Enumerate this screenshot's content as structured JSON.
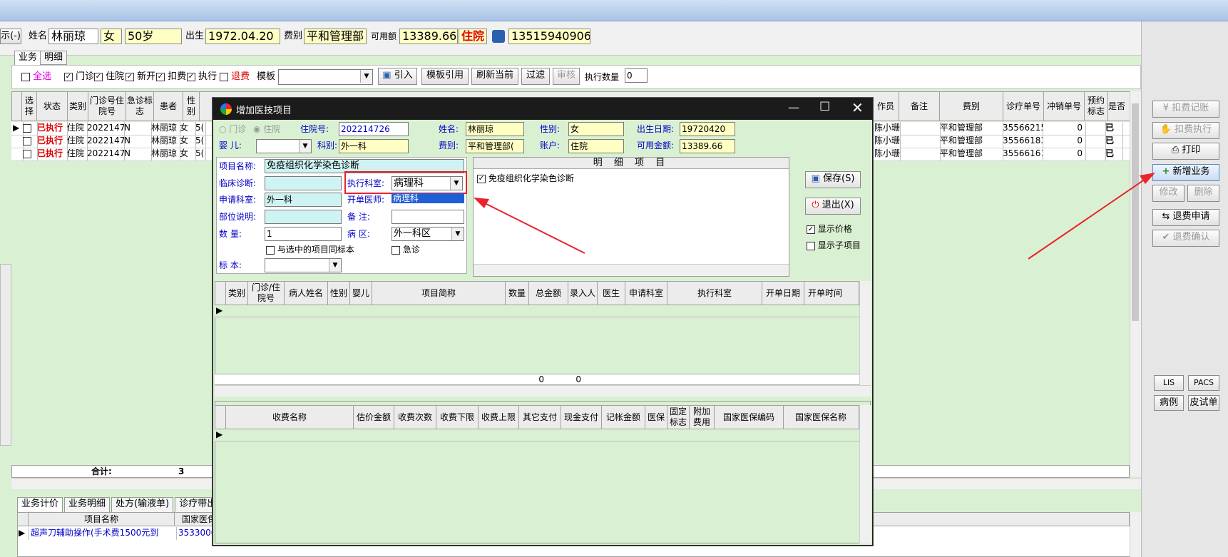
{
  "header": {
    "left_btn": "示(-)",
    "name_label": "姓名",
    "name": "林丽琼",
    "gender": "女",
    "age": "50岁",
    "birth_label": "出生",
    "birth": "1972.04.20",
    "fee_label": "费别",
    "fee": "平和管理部",
    "avail_label": "可用额",
    "avail": "13389.66",
    "status": "住院",
    "phone": "13515940906"
  },
  "tabs": {
    "biz": "业务",
    "detail": "明细"
  },
  "filters": {
    "all": "全选",
    "outpatient": "门诊",
    "inpatient": "住院",
    "new": "新开",
    "charge": "扣费",
    "execute": "执行",
    "refund": "退费",
    "template_label": "模板",
    "import_btn": "引入",
    "tpl_ref": "模板引用",
    "refresh": "刷新当前",
    "filter": "过滤",
    "audit": "审核",
    "exec_qty_label": "执行数量",
    "exec_qty": "0"
  },
  "main_grid": {
    "headers_left": [
      "选择",
      "状态",
      "类别",
      "门诊号住院号",
      "急诊标志",
      "患者",
      "性别"
    ],
    "headers_right": [
      "作员",
      "备注",
      "费别",
      "诊疗单号",
      "冲销单号",
      "预约标志",
      "是否"
    ],
    "rows": [
      {
        "status": "已执行",
        "type": "住院",
        "no": "2022147",
        "urgent": "N",
        "patient": "林丽琼",
        "gender": "女",
        "age": "5(",
        "op": "陈小珊",
        "fee": "平和管理部",
        "order": "35566215",
        "offset": "0",
        "flag": "已"
      },
      {
        "status": "已执行",
        "type": "住院",
        "no": "2022147",
        "urgent": "N",
        "patient": "林丽琼",
        "gender": "女",
        "age": "5(",
        "op": "陈小珊",
        "fee": "平和管理部",
        "order": "35566183",
        "offset": "0",
        "flag": "已"
      },
      {
        "status": "已执行",
        "type": "住院",
        "no": "2022147",
        "urgent": "N",
        "patient": "林丽琼",
        "gender": "女",
        "age": "5(",
        "op": "陈小珊",
        "fee": "平和管理部",
        "order": "35566161",
        "offset": "0",
        "flag": "已"
      }
    ],
    "total_label": "合计:",
    "total": "3"
  },
  "bottom_tabs": [
    "业务计价",
    "业务明细",
    "处方(输液单)",
    "诊疗带出"
  ],
  "bottom_grid": {
    "headers": [
      "项目名称",
      "国家医保编"
    ],
    "row": {
      "name": "超声刀辅助操作(手术费1500元到",
      "code": "35330000"
    }
  },
  "right_buttons": {
    "charge_record": "扣费记账",
    "charge_exec": "扣费执行",
    "print": "打印",
    "new_biz": "新增业务",
    "modify": "修改",
    "delete": "删除",
    "refund_apply": "退费申请",
    "refund_confirm": "退费确认",
    "lis": "LIS",
    "pacs": "PACS",
    "case": "病例",
    "skin": "皮试单"
  },
  "dialog": {
    "title": "增加医技项目",
    "outpatient": "门诊",
    "inpatient": "住院",
    "admit_no_label": "住院号:",
    "admit_no": "202214726",
    "name_label": "姓名:",
    "name": "林丽琼",
    "gender_label": "性别:",
    "gender": "女",
    "birth_label": "出生日期:",
    "birth": "19720420",
    "baby_label": "婴 儿:",
    "dept_label": "科别:",
    "dept": "外一科",
    "fee_label": "费别:",
    "fee": "平和管理部(",
    "account_label": "账户:",
    "account": "住院",
    "avail_label": "可用金额:",
    "avail": "13389.66",
    "item_label": "项目名称:",
    "item": "免疫组织化学染色诊断",
    "diag_label": "临床诊断:",
    "exec_dept_label": "执行科室:",
    "exec_dept": "病理科",
    "apply_dept_label": "申请科室:",
    "apply_dept": "外一科",
    "doctor_label": "开单医师:",
    "doctor": "病理科",
    "part_label": "部位说明:",
    "remark_label": "备 注:",
    "qty_label": "数 量:",
    "qty": "1",
    "ward_label": "病 区:",
    "ward": "外一科区",
    "same_specimen": "与选中的项目同标本",
    "urgent": "急诊",
    "specimen_label": "标 本:",
    "detail_title": "明 细 项 目",
    "detail_item": "免疫组织化学染色诊断",
    "save": "保存(S)",
    "exit": "退出(X)",
    "show_price": "显示价格",
    "show_sub": "显示子项目",
    "grid1_headers": [
      "类别",
      "门诊/住院号",
      "病人姓名",
      "性别",
      "婴儿",
      "项目简称",
      "数量",
      "总金额",
      "录入人",
      "医生",
      "申请科室",
      "执行科室",
      "开单日期",
      "开单时间"
    ],
    "grid1_totals": {
      "qty": "0",
      "amount": "0"
    },
    "grid2_headers": [
      "收费名称",
      "估价金额",
      "收费次数",
      "收费下限",
      "收费上限",
      "其它支付",
      "现金支付",
      "记帐金额",
      "医保",
      "固定标志",
      "附加费用",
      "国家医保编码",
      "国家医保名称"
    ]
  }
}
